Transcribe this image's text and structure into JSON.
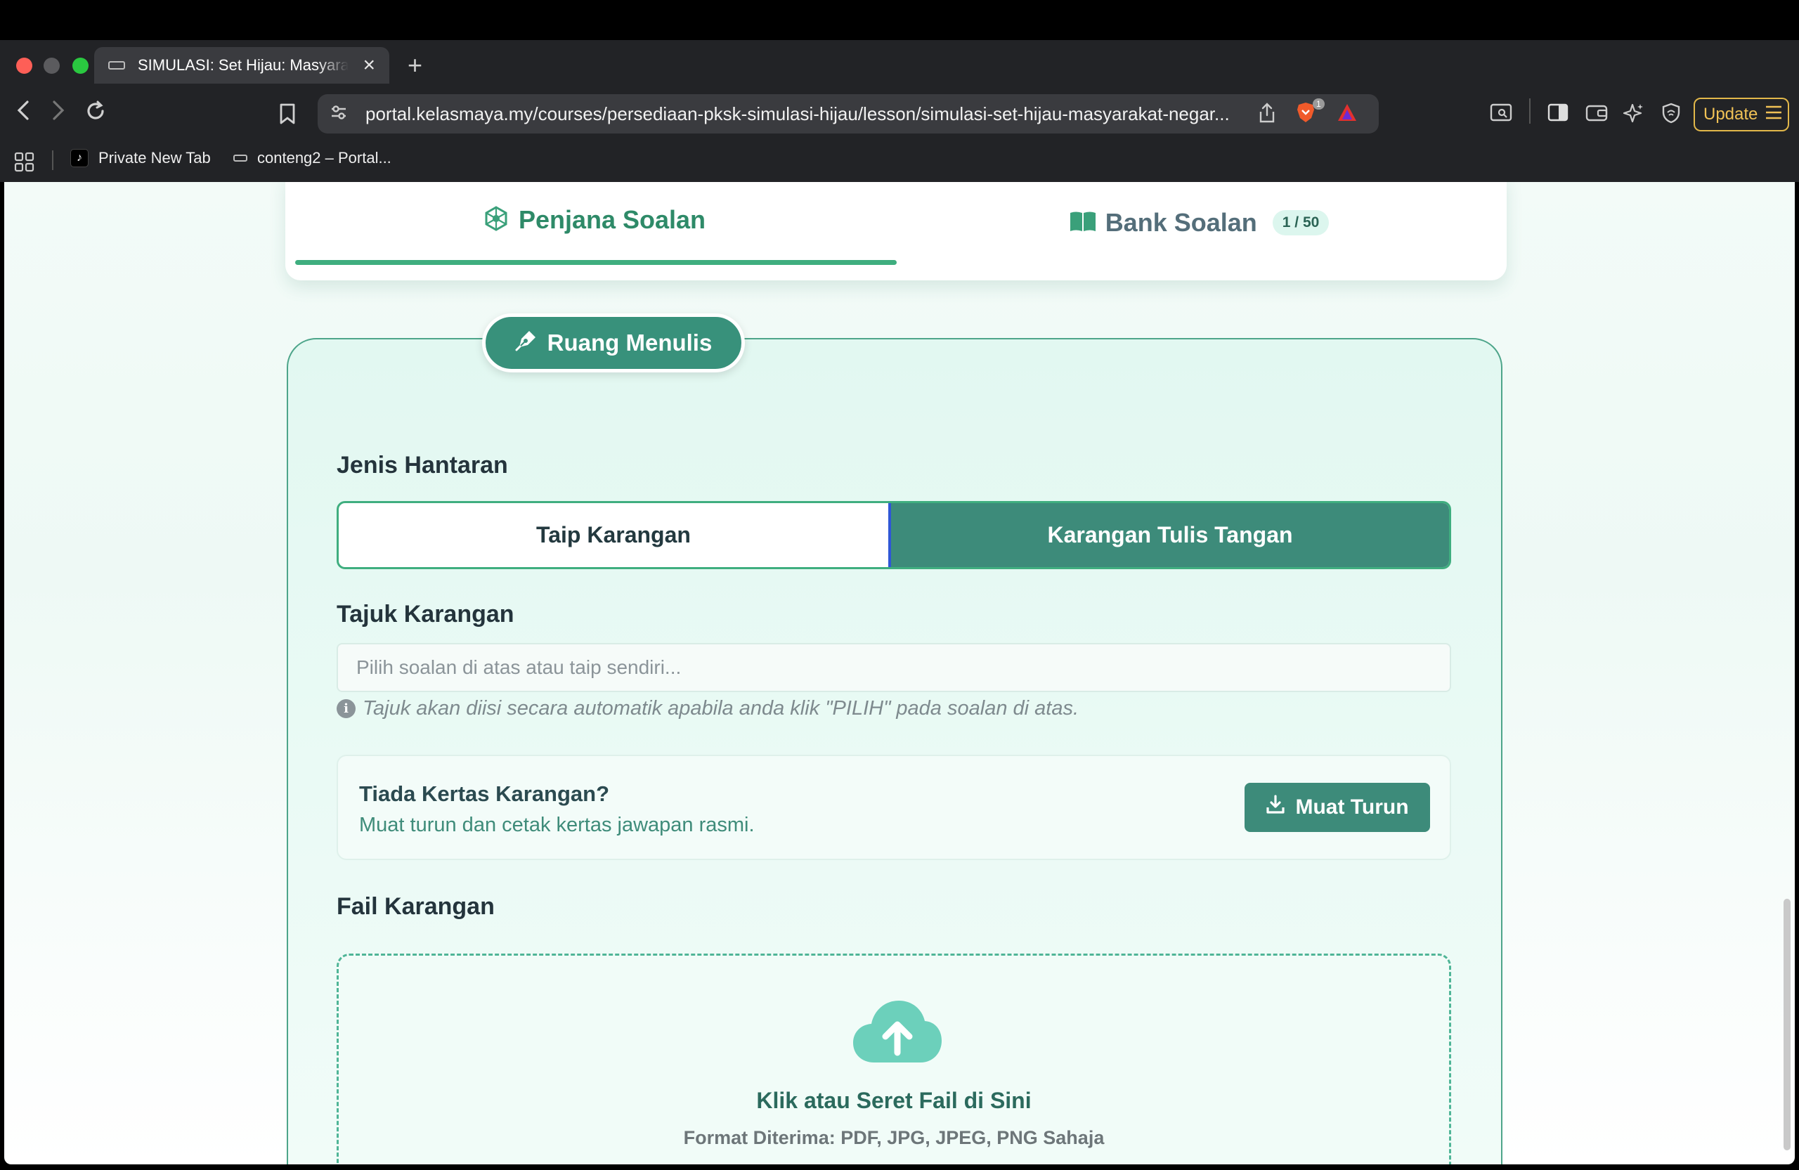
{
  "browser": {
    "tab_title": "SIMULASI: Set Hijau: Masyarakat",
    "url": "portal.kelasmaya.my/courses/persediaan-pksk-simulasi-hijau/lesson/simulasi-set-hijau-masyarakat-negar...",
    "brave_badge": "1",
    "update_label": "Update",
    "bookmarks": [
      {
        "label": "Private New Tab"
      },
      {
        "label": "conteng2 – Portal..."
      }
    ]
  },
  "tabs": {
    "penjana_label": "Penjana Soalan",
    "bank_label": "Bank Soalan",
    "bank_badge": "1 / 50"
  },
  "panel": {
    "title": "Ruang Menulis",
    "jenis_label": "Jenis Hantaran",
    "toggle": {
      "taip": "Taip Karangan",
      "tulis": "Karangan Tulis Tangan",
      "selected": "Karangan Tulis Tangan"
    },
    "tajuk_label": "Tajuk Karangan",
    "tajuk_placeholder": "Pilih soalan di atas atau taip sendiri...",
    "tajuk_hint": "Tajuk akan diisi secara automatik apabila anda klik \"PILIH\" pada soalan di atas.",
    "kertas": {
      "title": "Tiada Kertas Karangan?",
      "subtitle": "Muat turun dan cetak kertas jawapan rasmi.",
      "button": "Muat Turun"
    },
    "fail_label": "Fail Karangan",
    "dropzone": {
      "title": "Klik atau Seret Fail di Sini",
      "formats": "Format Diterima: PDF, JPG, JPEG, PNG Sahaja"
    }
  },
  "colors": {
    "accent_green": "#3fae7f",
    "button_teal": "#3d8b7a",
    "panel_bg": "#e2f8f1"
  }
}
